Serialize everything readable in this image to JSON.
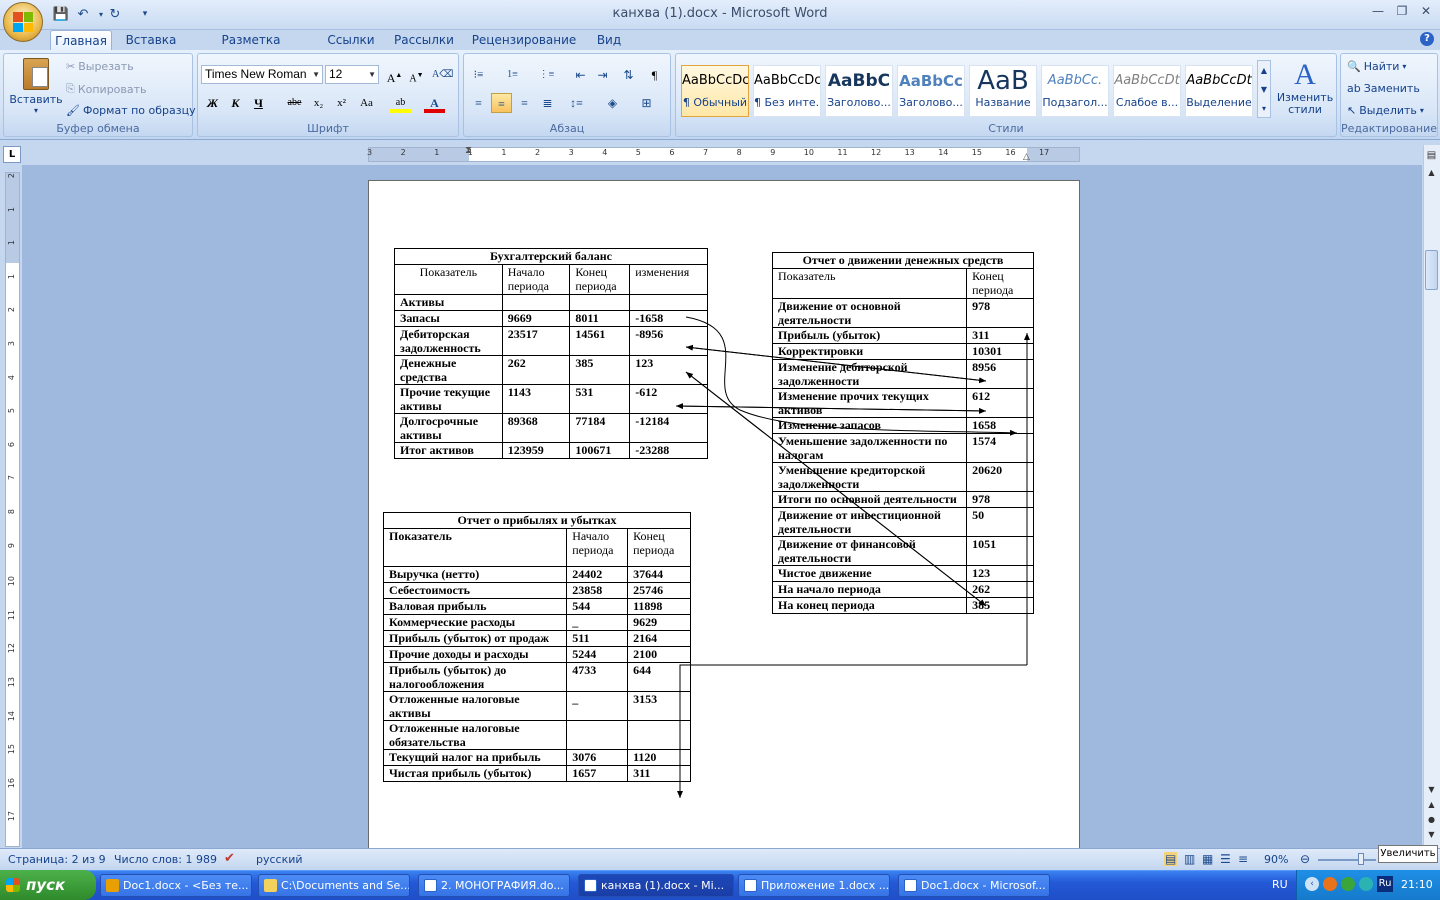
{
  "window": {
    "title": "канхва (1).docx - Microsoft Word"
  },
  "tabs": [
    "Главная",
    "Вставка",
    "Разметка страницы",
    "Ссылки",
    "Рассылки",
    "Рецензирование",
    "Вид"
  ],
  "clipboard": {
    "paste": "Вставить",
    "cut": "Вырезать",
    "copy": "Копировать",
    "format_painter": "Формат по образцу",
    "label": "Буфер обмена"
  },
  "font": {
    "name": "Times New Roman",
    "size": "12",
    "label": "Шрифт",
    "bold": "Ж",
    "italic": "К",
    "underline": "Ч",
    "strike": "abe",
    "sub": "x₂",
    "sup": "x²",
    "case": "Aa"
  },
  "paragraph": {
    "label": "Абзац"
  },
  "styles": {
    "label": "Стили",
    "items": [
      {
        "preview": "AaBbCcDc",
        "name": "¶ Обычный"
      },
      {
        "preview": "AaBbCcDc",
        "name": "¶ Без инте..."
      },
      {
        "preview": "AaBbC",
        "name": "Заголово..."
      },
      {
        "preview": "AaBbCc",
        "name": "Заголово..."
      },
      {
        "preview": "AaB",
        "name": "Название"
      },
      {
        "preview": "AaBbCc.",
        "name": "Подзагол..."
      },
      {
        "preview": "AaBbCcDt",
        "name": "Слабое в..."
      },
      {
        "preview": "AaBbCcDt",
        "name": "Выделение"
      }
    ],
    "change": "Изменить стили"
  },
  "editing": {
    "find": "Найти",
    "replace": "Заменить",
    "select": "Выделить",
    "label": "Редактирование"
  },
  "ruler": {
    "corner": "L",
    "h_numbers": [
      "3",
      "2",
      "1",
      "1",
      "1",
      "2",
      "3",
      "4",
      "5",
      "6",
      "7",
      "8",
      "9",
      "10",
      "11",
      "12",
      "13",
      "14",
      "15",
      "16",
      "17"
    ],
    "v_numbers": [
      "2",
      "1",
      "1",
      "1",
      "2",
      "3",
      "4",
      "5",
      "6",
      "7",
      "8",
      "9",
      "10",
      "11",
      "12",
      "13",
      "14",
      "15",
      "16",
      "17"
    ]
  },
  "balance": {
    "caption": "Бухгалтерский баланс",
    "header": [
      "Показатель",
      "Начало периода",
      "Конец периода",
      "изменения"
    ],
    "rows": [
      [
        "Активы",
        "",
        "",
        ""
      ],
      [
        "Запасы",
        "9669",
        "8011",
        "-1658"
      ],
      [
        "Дебиторская задолженность",
        "23517",
        "14561",
        "-8956"
      ],
      [
        "Денежные средства",
        "262",
        "385",
        "123"
      ],
      [
        "Прочие текущие активы",
        "1143",
        "531",
        "-612"
      ],
      [
        "Долгосрочные активы",
        "89368",
        "77184",
        "-12184"
      ],
      [
        "Итог активов",
        "123959",
        "100671",
        "-23288"
      ]
    ]
  },
  "income": {
    "caption": "Отчет о прибылях и убытках",
    "header": [
      "Показатель",
      "Начало периода",
      "Конец периода"
    ],
    "rows": [
      [
        "Выручка (нетто)",
        "24402",
        "37644"
      ],
      [
        "Себестоимость",
        "23858",
        "25746"
      ],
      [
        "Валовая прибыль",
        "544",
        "11898"
      ],
      [
        "Коммерческие расходы",
        "_",
        "9629"
      ],
      [
        "Прибыль (убыток) от продаж",
        "511",
        "2164"
      ],
      [
        "Прочие доходы и расходы",
        "5244",
        "2100"
      ],
      [
        "Прибыль (убыток) до налогообложения",
        "4733",
        "644"
      ],
      [
        "Отложенные налоговые активы",
        "_",
        "3153"
      ],
      [
        "Отложенные налоговые обязательства",
        "",
        ""
      ],
      [
        "Текущий налог на прибыль",
        "3076",
        "1120"
      ],
      [
        "Чистая прибыль (убыток)",
        "1657",
        "311"
      ]
    ]
  },
  "cashflow": {
    "caption": "Отчет о движении денежных средств",
    "header": [
      "Показатель",
      "Конец периода"
    ],
    "rows": [
      [
        "Движение от основной деятельности",
        "978"
      ],
      [
        "Прибыль (убыток)",
        "311"
      ],
      [
        "Корректировки",
        "10301"
      ],
      [
        "Изменение дебиторской задолженности",
        "8956"
      ],
      [
        "Изменение прочих текущих активов",
        "612"
      ],
      [
        "Изменение запасов",
        "1658"
      ],
      [
        "Уменьшение задолженности по налогам",
        "1574"
      ],
      [
        "Уменьшение кредиторской задолженности",
        "20620"
      ],
      [
        "Итоги по основной деятельности",
        "978"
      ],
      [
        "Движение от инвестиционной деятельности",
        "50"
      ],
      [
        "Движение от финансовой деятельности",
        "1051"
      ],
      [
        "Чистое движение",
        "123"
      ],
      [
        "На начало периода",
        "262"
      ],
      [
        "На конец периода",
        "385"
      ]
    ]
  },
  "status": {
    "page": "Страница: 2 из 9",
    "words": "Число слов: 1 989",
    "lang": "русский",
    "zoom": "90%",
    "tooltip": "Увеличить"
  },
  "taskbar": {
    "start": "пуск",
    "items": [
      "Doc1.docx - <Без те...",
      "C:\\Documents and Se...",
      "2. МОНОГРАФИЯ.do...",
      "канхва (1).docx - Mi...",
      "Приложение 1.docx ...",
      "Doc1.docx - Microsof..."
    ],
    "lang": "RU",
    "clock": "21:10",
    "tray_lang": "Ru"
  }
}
